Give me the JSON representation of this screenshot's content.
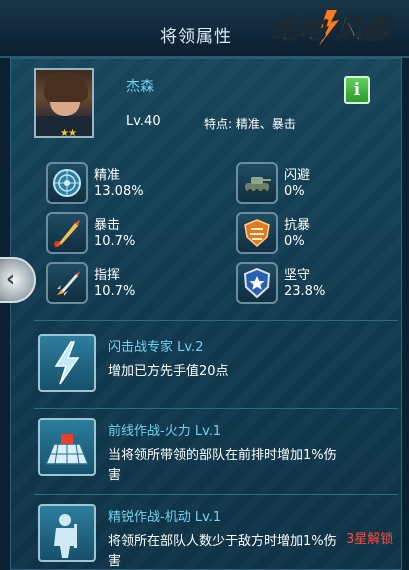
{
  "header": {
    "title": "将领属性",
    "brand_logo": "绝地风暴"
  },
  "hero": {
    "name": "杰森",
    "level": "Lv.40",
    "trait": "特点: 精准、暴击",
    "stars": "★★",
    "info_label": "i"
  },
  "stats": [
    {
      "label": "精准",
      "value": "13.08%",
      "icon": "radar-icon"
    },
    {
      "label": "闪避",
      "value": "0%",
      "icon": "tank-icon"
    },
    {
      "label": "暴击",
      "value": "10.7%",
      "icon": "missile-icon"
    },
    {
      "label": "抗暴",
      "value": "0%",
      "icon": "armor-shield-icon"
    },
    {
      "label": "指挥",
      "value": "10.7%",
      "icon": "rocket-icon"
    },
    {
      "label": "坚守",
      "value": "23.8%",
      "icon": "star-shield-icon"
    }
  ],
  "skills": [
    {
      "name": "闪击战专家 Lv.2",
      "desc": "增加已方先手值20点",
      "icon": "lightning-icon"
    },
    {
      "name": "前线作战-火力 Lv.1",
      "desc": "当将领所带领的部队在前排时增加1%伤害",
      "icon": "grid-formation-icon"
    },
    {
      "name": "精锐作战-机动 Lv.1",
      "desc": "将领所在部队人数少于敌方时增加1%伤害",
      "icon": "soldier-icon"
    }
  ],
  "unlock_text": "3星解锁",
  "colors": {
    "accent": "#6fd3f0",
    "unlock": "#ff4a3a",
    "info_green": "#3fb43b"
  }
}
